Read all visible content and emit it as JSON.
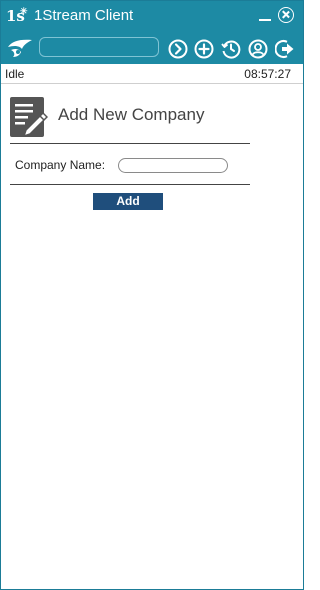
{
  "window": {
    "title": "1Stream Client",
    "logo_text": "1s",
    "accent_color": "#1d8aa4"
  },
  "toolbar": {
    "search": {
      "value": "",
      "placeholder": ""
    },
    "buttons": [
      {
        "icon": "chevron-right-circle-icon"
      },
      {
        "icon": "plus-circle-icon"
      },
      {
        "icon": "history-icon"
      },
      {
        "icon": "user-circle-icon"
      },
      {
        "icon": "logout-icon"
      }
    ]
  },
  "status": {
    "state": "Idle",
    "time": "08:57:27"
  },
  "form": {
    "title": "Add New Company",
    "company_name_label": "Company Name:",
    "company_name_value": "",
    "add_label": "Add",
    "button_color": "#1f4e7c"
  }
}
